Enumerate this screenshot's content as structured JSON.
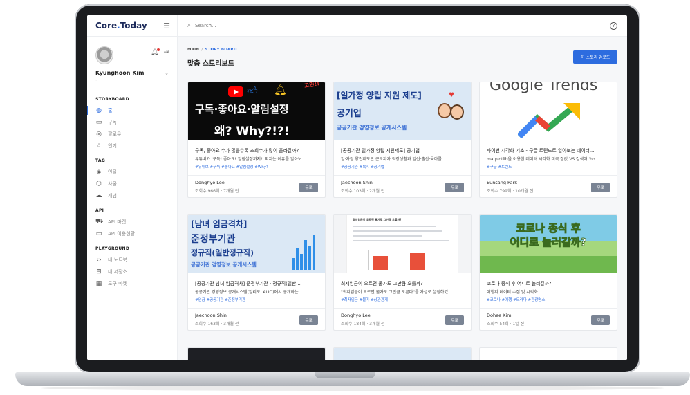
{
  "app": {
    "logo_main": "Core",
    "logo_dot": ".",
    "logo_end": "Today"
  },
  "search": {
    "placeholder": "Search..."
  },
  "profile": {
    "name": "Kyunghoon Kim",
    "sub": "-"
  },
  "sidebar": {
    "sections": [
      {
        "title": "STORYBOARD",
        "items": [
          {
            "label": "홈",
            "icon": "globe-icon",
            "active": true
          },
          {
            "label": "구독",
            "icon": "book-icon"
          },
          {
            "label": "팔로우",
            "icon": "target-icon"
          },
          {
            "label": "인기",
            "icon": "star-icon"
          }
        ]
      },
      {
        "title": "TAG",
        "items": [
          {
            "label": "인물",
            "icon": "layers-icon"
          },
          {
            "label": "사물",
            "icon": "cube-icon"
          },
          {
            "label": "개념",
            "icon": "cloud-icon"
          }
        ]
      },
      {
        "title": "API",
        "items": [
          {
            "label": "API 마켓",
            "icon": "cart-icon"
          },
          {
            "label": "API 이용현황",
            "icon": "monitor-icon"
          }
        ]
      },
      {
        "title": "PLAYGROUND",
        "items": [
          {
            "label": "내 노트북",
            "icon": "code-icon"
          },
          {
            "label": "내 저장소",
            "icon": "drive-icon"
          },
          {
            "label": "도구 마켓",
            "icon": "calendar-icon"
          }
        ]
      }
    ]
  },
  "breadcrumb": {
    "root": "MAIN",
    "sep": "/",
    "current": "STORY BOARD"
  },
  "page": {
    "title": "맞춤 스토리보드",
    "upload_label": "스토리 업로드"
  },
  "cards": [
    {
      "thumb_text": "구독·좋아요·알림설정",
      "thumb_text2": "왜? Why?!?!",
      "badge": "고민!!",
      "title": "구독, 좋아요 수가 많을수록 조회수가 많이 올라갈까?",
      "desc": "유튜버가 '구독! 좋아요! 알림설정까지!' 외치는 이유를 알아보...",
      "tags": "#유튜브 #구독 #좋아요 #알림설정 #Why?",
      "author": "Donghyo Lee",
      "meta": "조회수 966회 · 7개월 전",
      "price": "무료"
    },
    {
      "thumb_text": "[일가정 양립 지원 제도]",
      "thumb_text2": "공기업",
      "thumb_text3": "공공기관 경영정보 공개시스템",
      "title": "[공공기관 일가정 양립 지원제도] 공기업",
      "desc": "일·가정 양립제도란 근로자가 직장생활과 임신·출산·육아를 ...",
      "tags": "#공공기관 #복지 #공기업",
      "author": "Jaechoon Shin",
      "meta": "조회수 103회 · 2개월 전",
      "price": "무료"
    },
    {
      "thumb_text": "Google Trends",
      "title": "파이썬 시각화 기초 - 구글 트렌드로 알아보는 데이터...",
      "desc": "matplotlib을 이용한 데이터 시각화 미국 집값 VS 검색어 'ho...",
      "tags": "#구글 #트렌드",
      "author": "Eunsang Park",
      "meta": "조회수 799회 · 10개월 전",
      "price": "무료"
    },
    {
      "thumb_text": "[남녀 임금격차]",
      "thumb_text2": "준정부기관",
      "thumb_text3": "정규직(일반정규직)",
      "thumb_text4": "공공기관 경영정보 공개시스템",
      "title": "[공공기관 남녀 임금격차] 준정부기관 - 정규직(일반...",
      "desc": "공공기관 경영정보 공개시스템(알리오, ALIO)에서 공개하는 ...",
      "tags": "#임금 #공공기관 #준정부기관",
      "author": "Jaechoon Shin",
      "meta": "조회수 163회 · 3개월 전",
      "price": "무료"
    },
    {
      "thumb_text": "최저임금이 오르면 물가도 그만큼 오를까?",
      "title": "최저임금이 오르면 물가도 그만큼 오를까?",
      "desc": "\"최저임금이 오르면 물가도 그만큼 오른다\"를 가설로 설정하였...",
      "tags": "#최저임금 #물가 #상관관계",
      "author": "Donghyo Lee",
      "meta": "조회수 184회 · 3개월 전",
      "price": "무료"
    },
    {
      "thumb_text": "코로나 종식 후",
      "thumb_text2": "어디로 놀러갈까?",
      "title": "코로나 종식 후 어디로 놀러갈까?",
      "desc": "여행지 데이터 수집 및 시각화",
      "tags": "#코로나 #여행 #드라마 #관광명소",
      "author": "Dohee Kim",
      "meta": "조회수 54회 · 1일 전",
      "price": "무료"
    }
  ],
  "colors": {
    "accent": "#2d6cdf",
    "logo": "#1c2a5a",
    "button_grey": "#7a8494"
  }
}
